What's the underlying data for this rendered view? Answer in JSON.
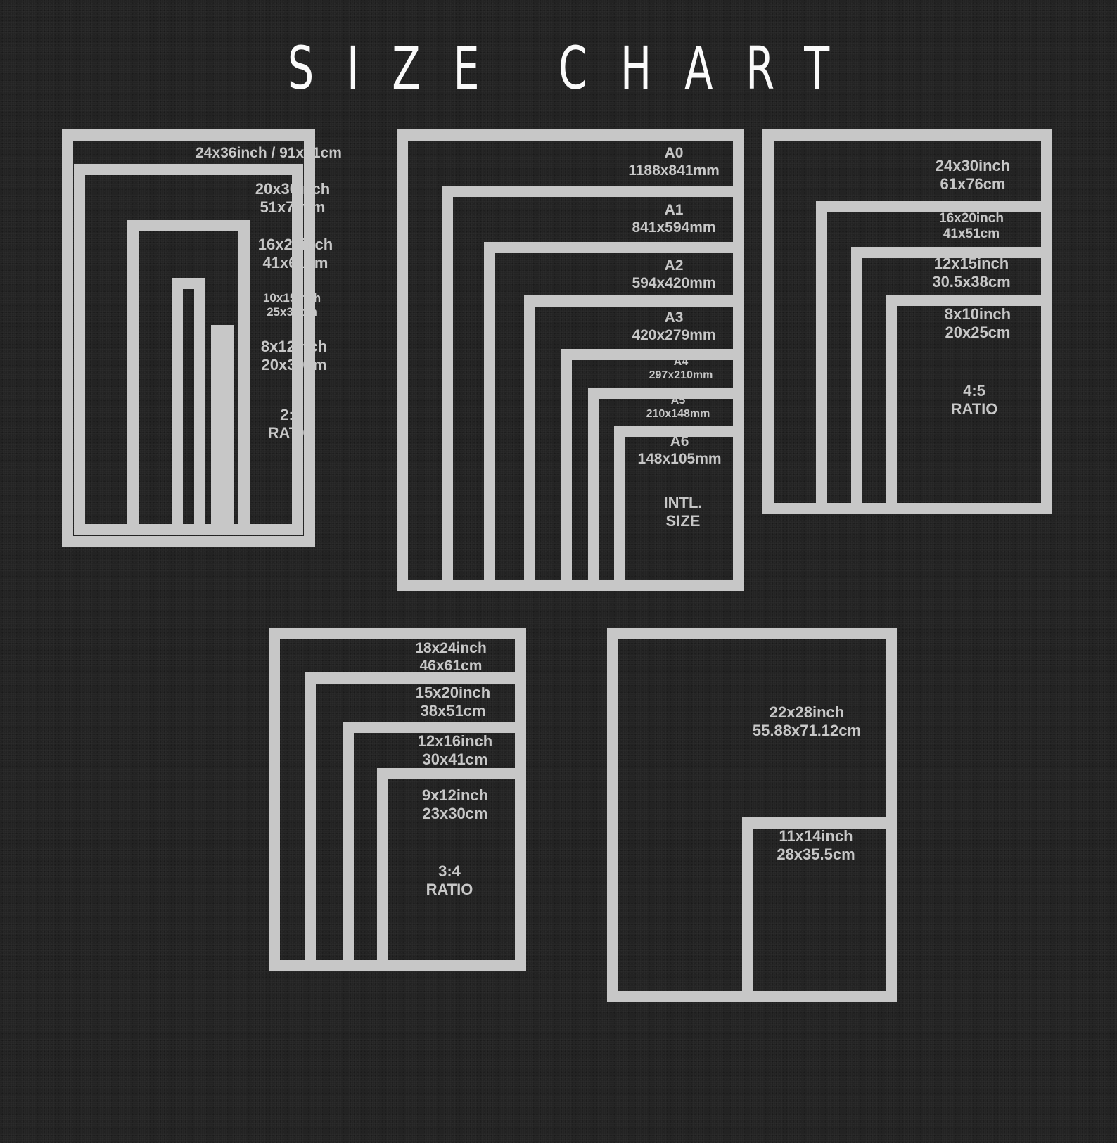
{
  "title": "SIZE CHART",
  "colors": {
    "background": "#232323",
    "frame": "#c7c7c7",
    "title": "#fafafa"
  },
  "groups": [
    {
      "id": "ratio-2-3",
      "sizes": [
        {
          "lines": [
            "24x36inch / 91x61cm"
          ]
        },
        {
          "lines": [
            "20x30inch",
            "51x76vm"
          ]
        },
        {
          "lines": [
            "16x24inch",
            "41x61cm"
          ]
        },
        {
          "lines": [
            "10x15inch",
            "25x38cm"
          ]
        },
        {
          "lines": [
            "8x12inch",
            "20x30cm"
          ]
        }
      ],
      "ratio_label": [
        "2:3",
        "RATIO"
      ]
    },
    {
      "id": "intl-size",
      "sizes": [
        {
          "lines": [
            "A0",
            "1188x841mm"
          ]
        },
        {
          "lines": [
            "A1",
            "841x594mm"
          ]
        },
        {
          "lines": [
            "A2",
            "594x420mm"
          ]
        },
        {
          "lines": [
            "A3",
            "420x279mm"
          ]
        },
        {
          "lines": [
            "A4",
            "297x210mm"
          ]
        },
        {
          "lines": [
            "A5",
            "210x148mm"
          ]
        },
        {
          "lines": [
            "A6",
            "148x105mm"
          ]
        }
      ],
      "ratio_label": [
        "INTL.",
        "SIZE"
      ]
    },
    {
      "id": "ratio-4-5",
      "sizes": [
        {
          "lines": [
            "24x30inch",
            "61x76cm"
          ]
        },
        {
          "lines": [
            "16x20inch",
            "41x51cm"
          ]
        },
        {
          "lines": [
            "12x15inch",
            "30.5x38cm"
          ]
        },
        {
          "lines": [
            "8x10inch",
            "20x25cm"
          ]
        }
      ],
      "ratio_label": [
        "4:5",
        "RATIO"
      ]
    },
    {
      "id": "ratio-3-4",
      "sizes": [
        {
          "lines": [
            "18x24inch",
            "46x61cm"
          ]
        },
        {
          "lines": [
            "15x20inch",
            "38x51cm"
          ]
        },
        {
          "lines": [
            "12x16inch",
            "30x41cm"
          ]
        },
        {
          "lines": [
            "9x12inch",
            "23x30cm"
          ]
        }
      ],
      "ratio_label": [
        "3:4",
        "RATIO"
      ]
    },
    {
      "id": "other",
      "sizes": [
        {
          "lines": [
            "22x28inch",
            "55.88x71.12cm"
          ]
        },
        {
          "lines": [
            "11x14inch",
            "28x35.5cm"
          ]
        }
      ]
    }
  ]
}
